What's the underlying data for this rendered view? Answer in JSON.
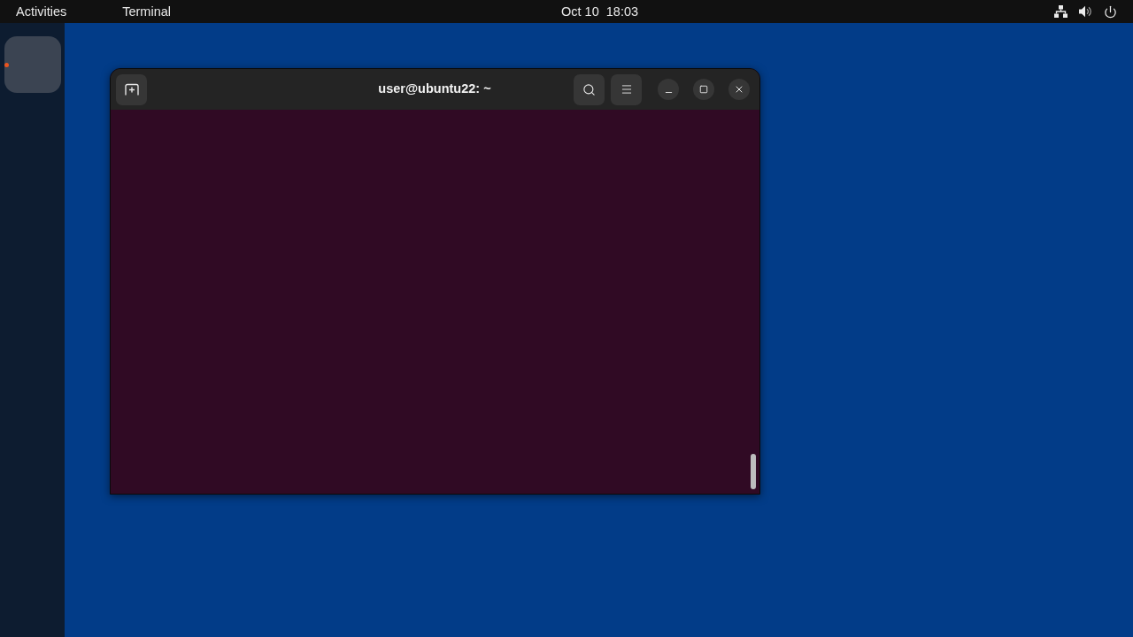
{
  "top_bar": {
    "activities": "Activities",
    "app_menu": "Terminal",
    "clock": "Oct 10  18:03"
  },
  "dock": {
    "apps": [
      {
        "running": true
      }
    ]
  },
  "terminal": {
    "title": "user@ubuntu22: ~"
  }
}
